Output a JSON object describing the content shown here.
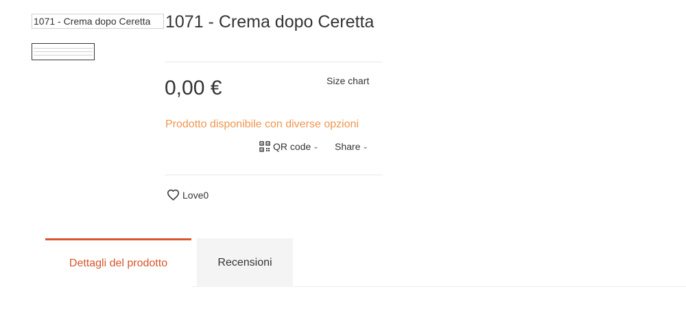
{
  "product": {
    "image_alt": "1071 - Crema dopo Ceretta",
    "title": "1071 - Crema dopo Ceretta",
    "price": "0,00 €",
    "size_chart_label": "Size chart",
    "availability": "Prodotto disponibile con diverse opzioni"
  },
  "actions": {
    "qr_label": "QR code",
    "share_label": "Share",
    "love_label": "Love",
    "love_count": "0"
  },
  "tabs": [
    {
      "label": "Dettagli del prodotto",
      "active": true
    },
    {
      "label": "Recensioni",
      "active": false
    }
  ],
  "colors": {
    "accent": "#d9542b",
    "availability": "#f0964f"
  },
  "icons": [
    "qr-code-icon",
    "chevron-down-icon",
    "heart-icon"
  ]
}
